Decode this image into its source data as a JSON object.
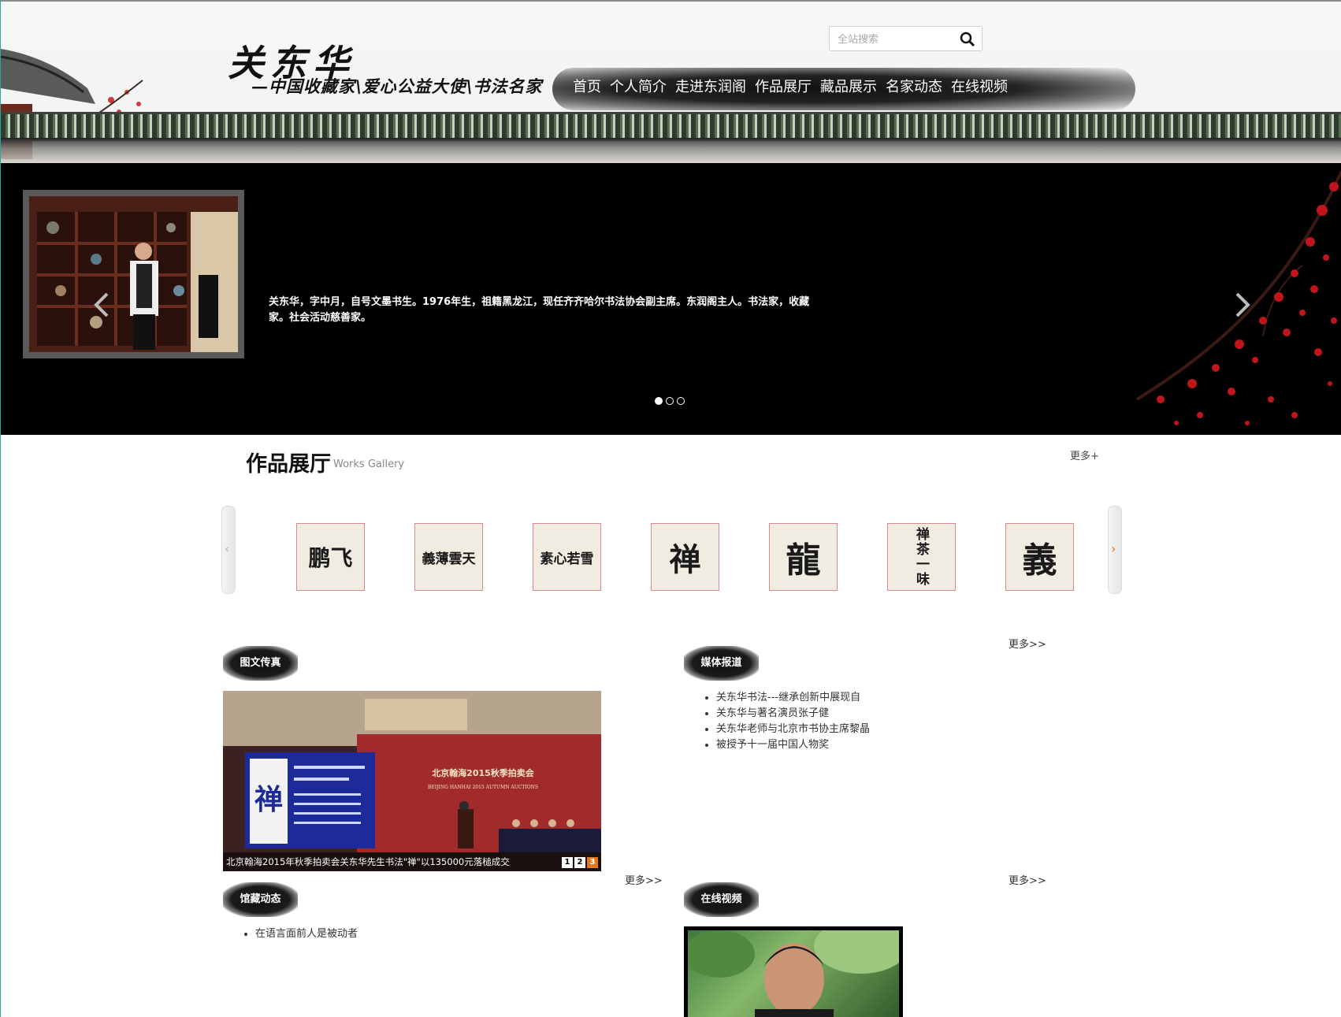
{
  "header": {
    "brand_name": "关东华",
    "brand_subtitle": "—中国收藏家\\爱心公益大使\\书法名家",
    "nav": [
      "首页",
      "个人简介",
      "走进东润阁",
      "作品展厅",
      "藏品展示",
      "名家动态",
      "在线视频"
    ],
    "search": {
      "placeholder": "全站搜索",
      "icon": "search-icon"
    }
  },
  "banner": {
    "text": "关东华，字中月，自号文墨书生。1976年生，祖籍黑龙江，现任齐齐哈尔书法协会副主席。东润阁主人。书法家，收藏家。社会活动慈善家。",
    "slides": 3,
    "active_slide": 1
  },
  "gallery": {
    "title": "作品展厅",
    "subtitle": "Works Gallery",
    "more": "更多+",
    "items": [
      {
        "glyphs": "鹏飞",
        "orientation": "horizontal"
      },
      {
        "glyphs": "義薄雲天",
        "orientation": "horizontal"
      },
      {
        "glyphs": "素心若雪",
        "orientation": "horizontal"
      },
      {
        "glyphs": "禅",
        "orientation": "vertical"
      },
      {
        "glyphs": "龍",
        "orientation": "vertical"
      },
      {
        "glyphs": "禅茶一味",
        "orientation": "vertical"
      },
      {
        "glyphs": "義",
        "orientation": "vertical"
      }
    ]
  },
  "sections": {
    "photo_news": {
      "title": "图文传真",
      "caption": "北京翰海2015年秋季拍卖会关东华先生书法\"禅\"以135000元落槌成交",
      "pager": [
        "1",
        "2",
        "3"
      ],
      "active_page": "3",
      "screen_title": "北京翰海2015秋季拍卖会",
      "screen_subtitle": "BEIJING HANHAI 2015 AUTUMN AUCTIONS",
      "screen_glyph": "禅",
      "more": "更多>>"
    },
    "media": {
      "title": "媒体报道",
      "more": "更多>>",
      "items": [
        "关东华书法---继承创新中展现自",
        "关东华与著名演员张子健",
        "关东华老师与北京市书协主席黎晶",
        "被授予十一届中国人物奖"
      ]
    },
    "collection": {
      "title": "馆藏动态",
      "more": "更多>>",
      "items": [
        "在语言面前人是被动者"
      ]
    },
    "video": {
      "title": "在线视频",
      "more": "更多>>"
    }
  },
  "colors": {
    "accent_orange": "#e3791c",
    "thumb_border": "#d98a8a",
    "blossom_red": "#c0161b"
  }
}
